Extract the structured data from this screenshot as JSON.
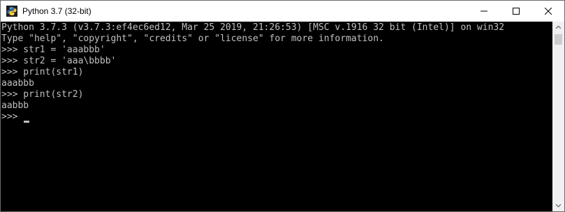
{
  "window": {
    "title": "Python 3.7 (32-bit)",
    "app_icon": "python-icon"
  },
  "controls": {
    "minimize_icon": "minimize-icon",
    "maximize_icon": "maximize-icon",
    "close_icon": "close-icon"
  },
  "console": {
    "lines": [
      "Python 3.7.3 (v3.7.3:ef4ec6ed12, Mar 25 2019, 21:26:53) [MSC v.1916 32 bit (Intel)] on win32",
      "Type \"help\", \"copyright\", \"credits\" or \"license\" for more information.",
      ">>> str1 = 'aaabbb'",
      ">>> str2 = 'aaa\\bbbb'",
      ">>> print(str1)",
      "aaabbb",
      ">>> print(str2)",
      "aabbb",
      ">>> "
    ],
    "colors": {
      "background": "#000000",
      "text": "#c0c0c0"
    }
  }
}
